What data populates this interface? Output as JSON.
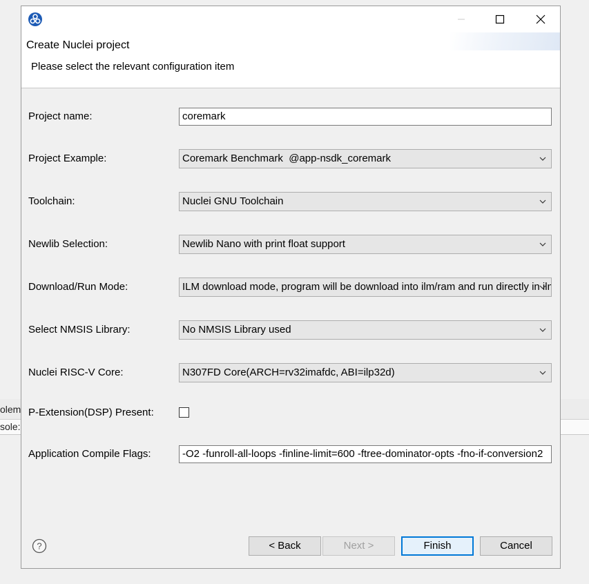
{
  "background_app": {
    "text_row1": "olem",
    "text_row2": "sole:"
  },
  "dialog": {
    "icon": "nuclei-logo-icon",
    "title": "Create Nuclei project",
    "subtitle": "Please select the relevant configuration item",
    "window_controls": {
      "minimize": "minimize-icon",
      "maximize": "maximize-icon",
      "close": "close-icon"
    }
  },
  "form": {
    "project_name": {
      "label": "Project name:",
      "value": "coremark"
    },
    "project_example": {
      "label": "Project Example:",
      "value": "Coremark Benchmark  @app-nsdk_coremark"
    },
    "toolchain": {
      "label": "Toolchain:",
      "value": "Nuclei GNU Toolchain"
    },
    "newlib": {
      "label": "Newlib Selection:",
      "value": "Newlib Nano with print float support"
    },
    "download_mode": {
      "label": "Download/Run Mode:",
      "value": "ILM download mode, program will be download into ilm/ram and run directly in ilm/ram"
    },
    "nmsis_library": {
      "label": "Select NMSIS Library:",
      "value": "No NMSIS Library used"
    },
    "riscv_core": {
      "label": "Nuclei RISC-V Core:",
      "value": "N307FD Core(ARCH=rv32imafdc, ABI=ilp32d)"
    },
    "p_extension": {
      "label": "P-Extension(DSP) Present:",
      "checked": false
    },
    "compile_flags": {
      "label": "Application Compile Flags:",
      "value": "-O2 -funroll-all-loops -finline-limit=600 -ftree-dominator-opts -fno-if-conversion2"
    }
  },
  "buttons": {
    "help": "help-icon",
    "back": "< Back",
    "next": "Next >",
    "finish": "Finish",
    "cancel": "Cancel"
  },
  "colors": {
    "accent": "#0078d7",
    "logo": "#1d5bb5"
  }
}
